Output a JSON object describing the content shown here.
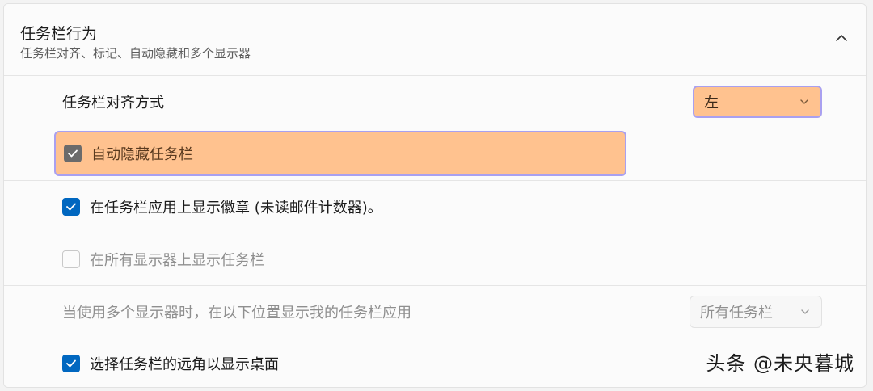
{
  "section": {
    "title": "任务栏行为",
    "subtitle": "任务栏对齐、标记、自动隐藏和多个显示器",
    "collapse_icon": "chevron-up-icon"
  },
  "rows": {
    "alignment": {
      "label": "任务栏对齐方式",
      "dropdown_value": "左"
    },
    "auto_hide": {
      "label": "自动隐藏任务栏",
      "checked": true
    },
    "badges": {
      "label": "在任务栏应用上显示徽章 (未读邮件计数器)。",
      "checked": true
    },
    "all_displays": {
      "label": "在所有显示器上显示任务栏",
      "checked": false,
      "disabled": true
    },
    "multi_display": {
      "label": "当使用多个显示器时，在以下位置显示我的任务栏应用",
      "dropdown_value": "所有任务栏",
      "disabled": true
    },
    "far_corner": {
      "label": "选择任务栏的远角以显示桌面",
      "checked": true
    }
  },
  "watermark": "头条 @未央暮城",
  "colors": {
    "accent": "#0067c0",
    "highlight_fill": "#ffc28f",
    "highlight_border": "#a9a0f0"
  }
}
